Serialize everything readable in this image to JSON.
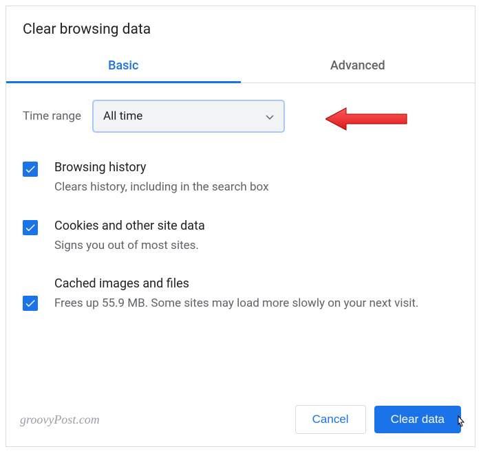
{
  "dialog": {
    "title": "Clear browsing data"
  },
  "tabs": {
    "basic": "Basic",
    "advanced": "Advanced"
  },
  "timeRange": {
    "label": "Time range",
    "value": "All time"
  },
  "options": [
    {
      "title": "Browsing history",
      "description": "Clears history, including in the search box"
    },
    {
      "title": "Cookies and other site data",
      "description": "Signs you out of most sites."
    },
    {
      "title": "Cached images and files",
      "description": "Frees up 55.9 MB. Some sites may load more slowly on your next visit."
    }
  ],
  "buttons": {
    "cancel": "Cancel",
    "clear": "Clear data"
  },
  "watermark": "groovyPost.com"
}
